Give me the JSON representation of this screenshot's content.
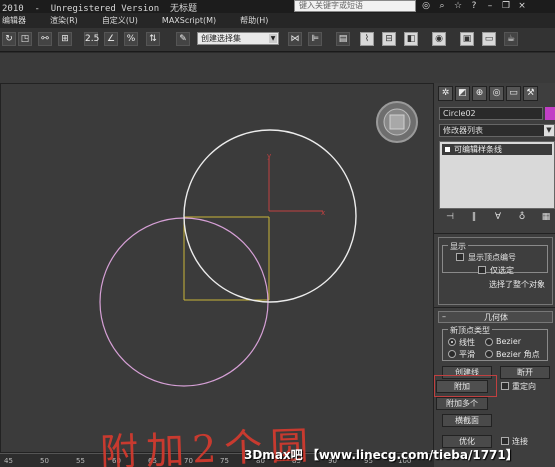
{
  "titlebar": {
    "title": "2010  -  Unregistered Version  无标题",
    "search_placeholder": "键入关键字或短语"
  },
  "menubar": {
    "items": [
      "编辑器",
      "渲染(R)",
      "自定义(U)",
      "MAXScript(M)",
      "帮助(H)"
    ]
  },
  "toolbar": {
    "selection_set": "创建选择集",
    "snap_label": "2.5"
  },
  "viewport": {
    "circle_colors": {
      "white": "#e8e8e8",
      "pink": "#d6a0d6",
      "box": "#c9b43a"
    },
    "axis_x_color": "#c24040",
    "axis_y_color": "#c24040"
  },
  "command_panel": {
    "object_name": "Circle02",
    "object_color": "#c23fc5",
    "modifier_list": "修改器列表",
    "stack_item": "可编辑样条线",
    "selection_rollout": {
      "title": "显示",
      "show_vertex_numbers": "显示顶点编号",
      "selected_only": "仅选定",
      "status": "选择了整个对象"
    },
    "geometry_rollout": {
      "title": "几何体",
      "new_vertex_type": "新顶点类型",
      "linear": "线性",
      "bezier": "Bezier",
      "smooth": "平滑",
      "bezier_corner": "Bezier 角点",
      "create_line": "创建线",
      "break": "断开",
      "attach": "附加",
      "reorient": "重定向",
      "attach_multiple": "附加多个",
      "cross_section": "横截面",
      "bottom_left": "优化",
      "bottom_right": "连接"
    }
  },
  "ruler": {
    "ticks": [
      "45",
      "50",
      "55",
      "60",
      "65",
      "70",
      "75",
      "80",
      "85",
      "90",
      "95",
      "100"
    ]
  },
  "annotation": {
    "handwriting": "附加2个圆",
    "watermark": "3Dmax吧 【www.linecg.com/tieba/1771】"
  }
}
